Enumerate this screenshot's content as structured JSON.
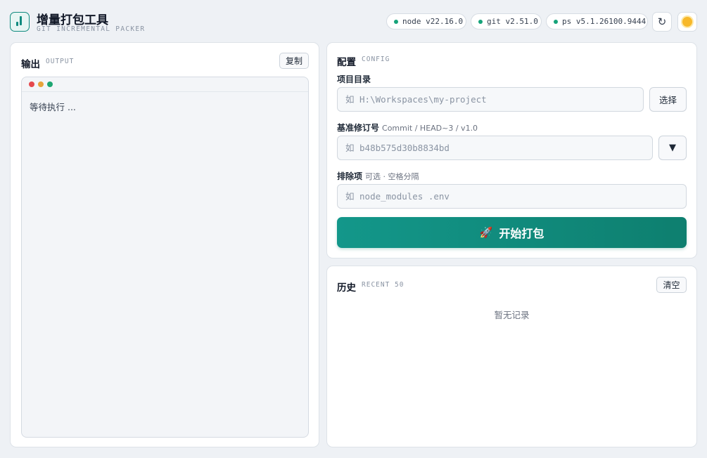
{
  "header": {
    "title": "增量打包工具",
    "subtitle": "GIT INCREMENTAL PACKER",
    "env": [
      {
        "label": "node v22.16.0",
        "status_color": "#16a37a"
      },
      {
        "label": "git v2.51.0",
        "status_color": "#16a37a"
      },
      {
        "label": "ps v5.1.26100.9444",
        "status_color": "#16a37a"
      }
    ],
    "refresh_icon": "↻",
    "theme_icon": "sun-icon"
  },
  "output": {
    "title": "输出",
    "tag": "OUTPUT",
    "copy_label": "复制",
    "text": "等待执行 ..."
  },
  "config": {
    "title": "配置",
    "tag": "CONFIG",
    "project_label": "项目目录",
    "project_placeholder": "如 H:\\Workspaces\\my-project",
    "choose_label": "选择",
    "revision_label": "基准修订号",
    "revision_hint": "Commit / HEAD~3 / v1.0",
    "revision_placeholder": "如 b48b575d30b8834bd",
    "dropdown_icon": "▼",
    "exclude_label": "排除项",
    "exclude_hint": "可选 · 空格分隔",
    "exclude_placeholder": "如 node_modules .env",
    "start_label": "开始打包",
    "start_icon": "🚀"
  },
  "history": {
    "title": "历史",
    "tag": "RECENT 50",
    "clear_label": "清空",
    "empty_text": "暂无记录"
  },
  "colors": {
    "accent": "#0f8a7e",
    "background": "#eef1f5",
    "status_ok": "#16a37a",
    "traffic_red": "#e5484d",
    "traffic_yellow": "#e8a33b",
    "traffic_green": "#1ea672"
  }
}
